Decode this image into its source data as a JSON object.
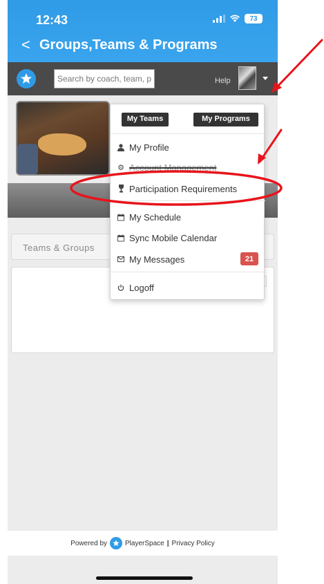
{
  "status_bar": {
    "time": "12:43",
    "battery": "73"
  },
  "header": {
    "back_label": "<",
    "title": "Groups,Teams & Programs"
  },
  "appbar": {
    "search_placeholder": "Search by coach, team, p",
    "help_label": "Help",
    "brand_color": "#2f9be6"
  },
  "content": {
    "teams_tab_label": "Teams & Groups"
  },
  "menu": {
    "my_teams": "My Teams",
    "my_programs": "My Programs",
    "items": [
      {
        "label": "My Profile",
        "icon": "user-icon"
      },
      {
        "label": "Account Management",
        "icon": "gear-icon"
      },
      {
        "label": "Participation Requirements",
        "icon": "trophy-icon"
      },
      {
        "label": "My Schedule",
        "icon": "calendar-icon"
      },
      {
        "label": "Sync Mobile Calendar",
        "icon": "calendar-icon"
      },
      {
        "label": "My Messages",
        "icon": "envelope-icon"
      },
      {
        "label": "Logoff",
        "icon": "power-icon"
      }
    ],
    "messages_count": "21",
    "badge_color": "#d9534f"
  },
  "footer": {
    "powered_by": "Powered by",
    "brand": "PlayerSpace",
    "separator": "|",
    "privacy": "Privacy Policy"
  },
  "annotations": {
    "color": "#e8141b"
  }
}
